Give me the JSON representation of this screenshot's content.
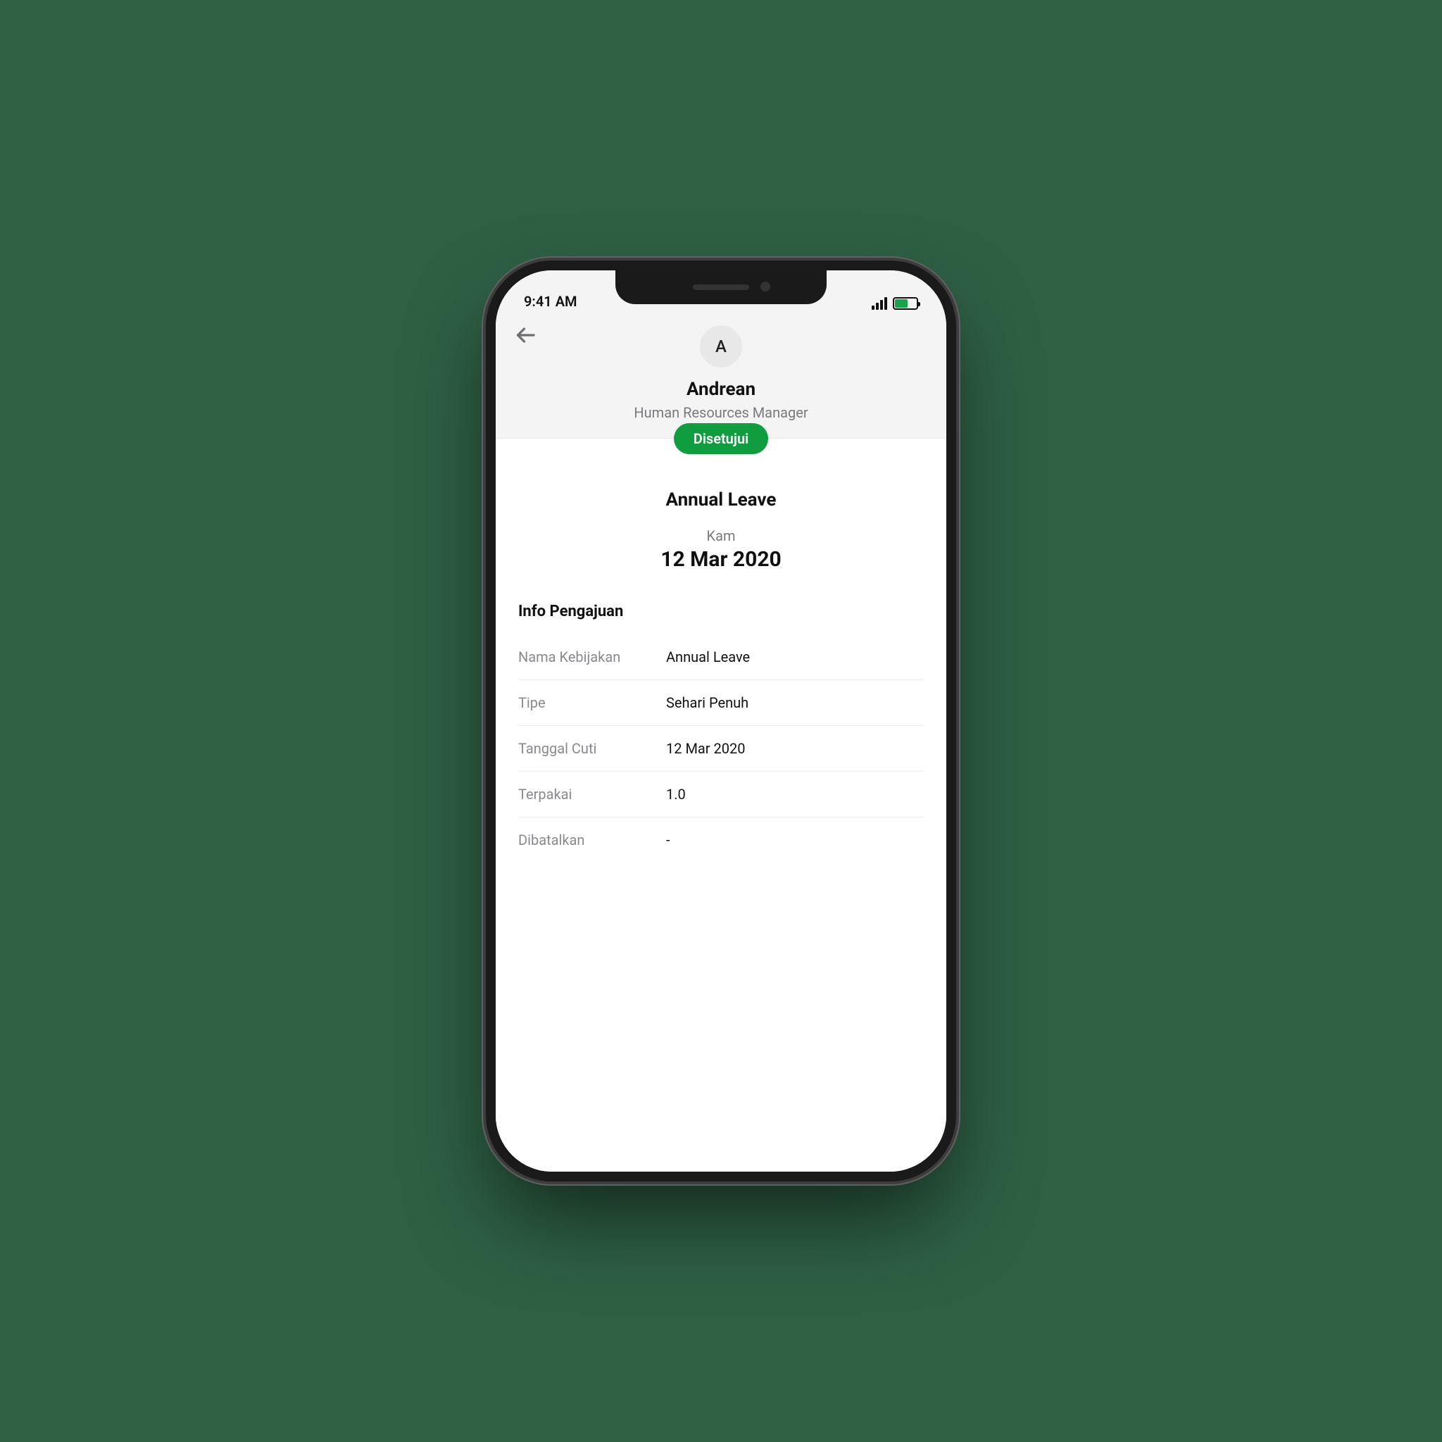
{
  "status_bar": {
    "time": "9:41 AM"
  },
  "header": {
    "avatar_initial": "A",
    "user_name": "Andrean",
    "user_role": "Human Resources Manager"
  },
  "status_pill": {
    "label": "Disetujui",
    "color": "#0f9d3f"
  },
  "leave": {
    "title": "Annual Leave",
    "day_label": "Kam",
    "date": "12 Mar 2020"
  },
  "section": {
    "title": "Info Pengajuan"
  },
  "info_rows": [
    {
      "label": "Nama Kebijakan",
      "value": "Annual Leave"
    },
    {
      "label": "Tipe",
      "value": "Sehari Penuh"
    },
    {
      "label": "Tanggal Cuti",
      "value": "12 Mar 2020"
    },
    {
      "label": "Terpakai",
      "value": "1.0"
    },
    {
      "label": "Dibatalkan",
      "value": "-"
    }
  ]
}
